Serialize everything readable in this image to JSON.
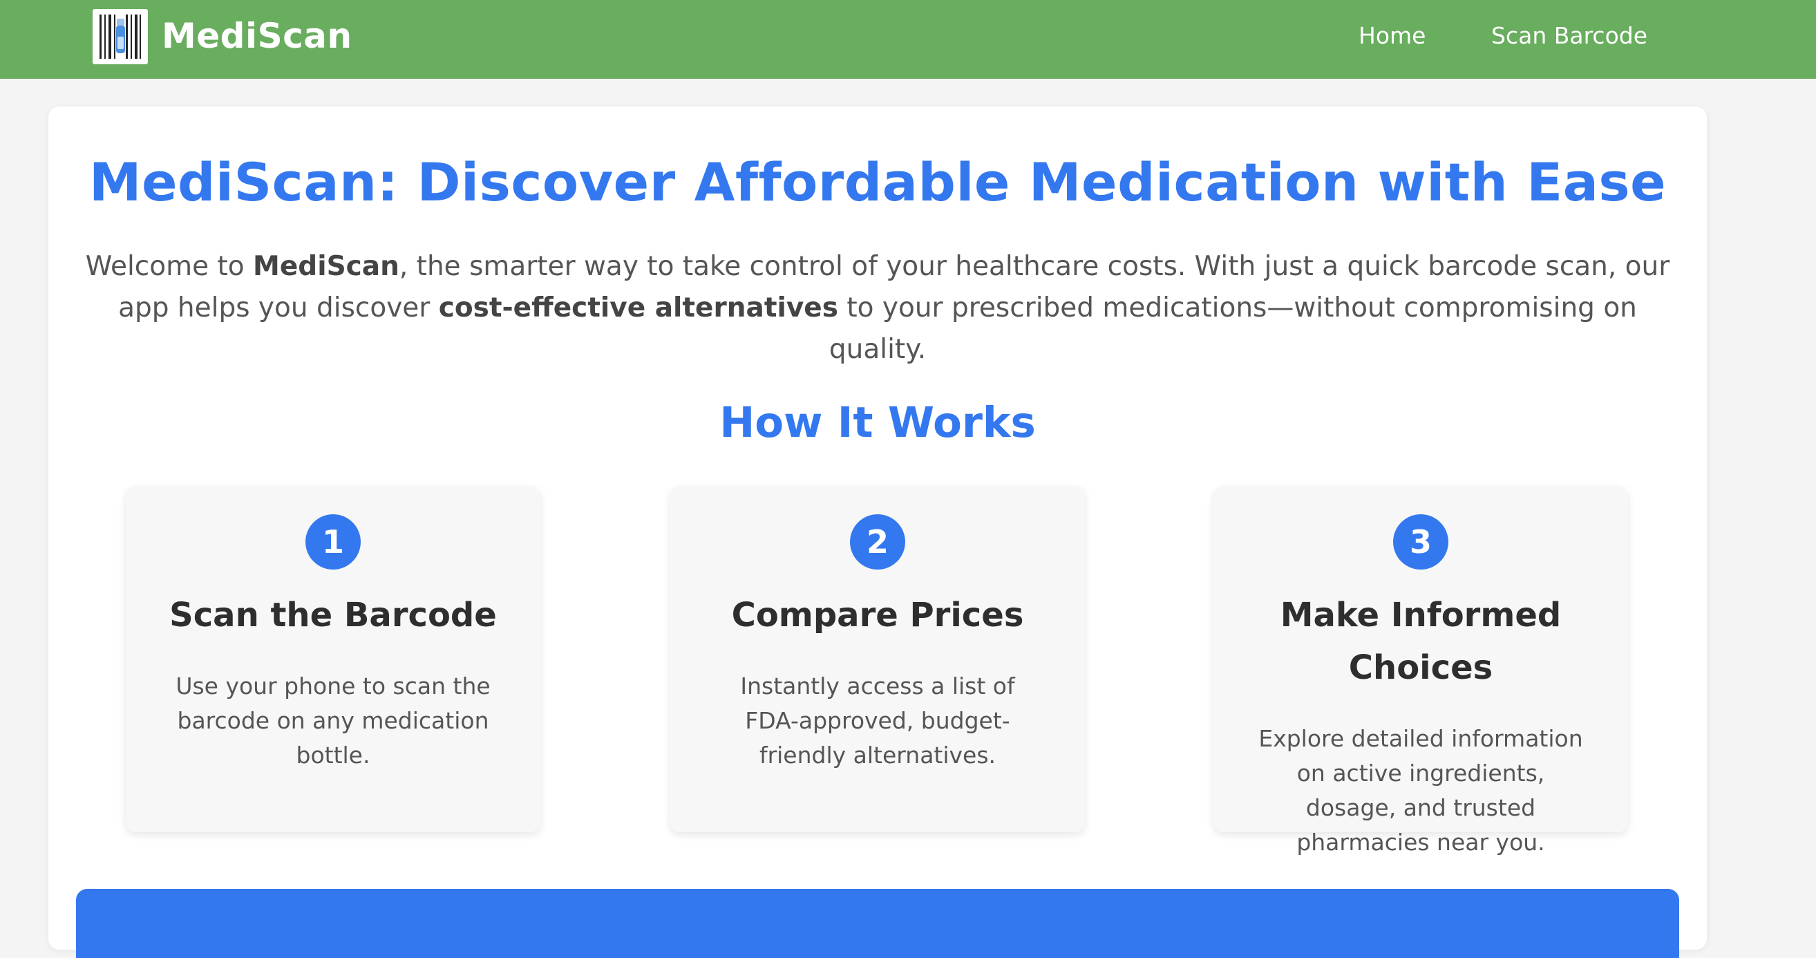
{
  "nav": {
    "brand": "MediScan",
    "links": [
      "Home",
      "Scan Barcode"
    ],
    "bg_color": "#69ad5e"
  },
  "hero": {
    "title": "MediScan: Discover Affordable Medication with Ease",
    "intro": {
      "p1": "Welcome to ",
      "b1": "MediScan",
      "p2": ", the smarter way to take control of your healthcare costs. With just a quick barcode scan, our app helps you discover ",
      "b2": "cost-effective alternatives",
      "p3": " to your prescribed medications—without compromising on quality."
    }
  },
  "how_it_works": {
    "title": "How It Works",
    "steps": [
      {
        "number": "1",
        "title": "Scan the Barcode",
        "description": "Use your phone to scan the barcode on any medication bottle."
      },
      {
        "number": "2",
        "title": "Compare Prices",
        "description": "Instantly access a list of FDA-approved, budget-friendly alternatives."
      },
      {
        "number": "3",
        "title": "Make Informed Choices",
        "description": "Explore detailed information on active ingredients, dosage, and trusted pharmacies near you."
      }
    ]
  },
  "colors": {
    "accent": "#3478ef",
    "nav": "#69ad5e"
  },
  "icons": {
    "logo": "barcode-pill-icon"
  }
}
